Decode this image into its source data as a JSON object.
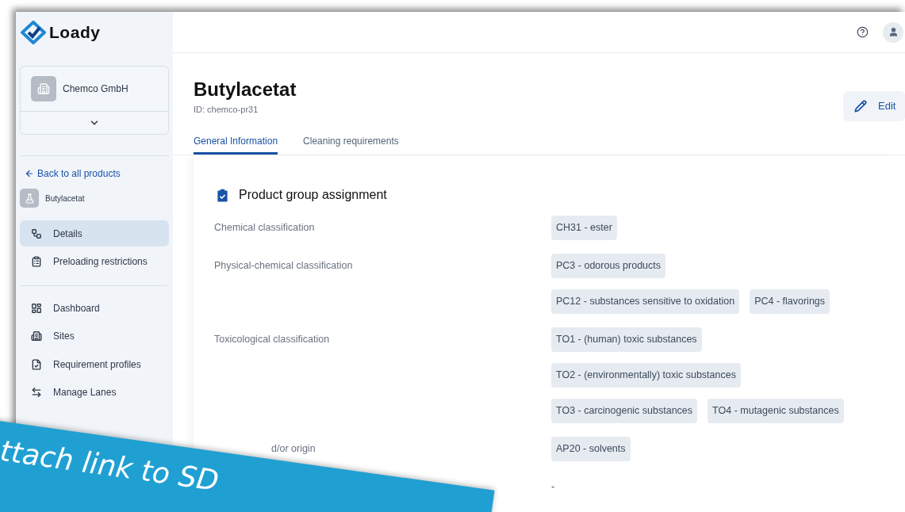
{
  "brand": {
    "name": "Loady"
  },
  "company": {
    "name": "Chemco GmbH"
  },
  "sidebar": {
    "back_link": "Back to all products",
    "product": "Butylacetat",
    "product_nav": [
      {
        "label": "Details",
        "selected": true
      },
      {
        "label": "Preloading restrictions",
        "selected": false
      }
    ],
    "main_nav": [
      {
        "label": "Dashboard",
        "selected": false
      },
      {
        "label": "Sites",
        "selected": false
      },
      {
        "label": "Requirement profiles",
        "selected": false
      },
      {
        "label": "Manage Lanes",
        "selected": false
      }
    ]
  },
  "page": {
    "title": "Butylacetat",
    "id": "ID: chemco-pr31",
    "edit_button": "Edit"
  },
  "tabs": [
    {
      "label": "General Information",
      "selected": true
    },
    {
      "label": "Cleaning requirements",
      "selected": false
    }
  ],
  "section": {
    "title": "Product group assignment",
    "rows": [
      {
        "label": "Chemical classification",
        "lines": [
          [
            "CH31 - ester"
          ]
        ]
      },
      {
        "label": "Physical-chemical classification",
        "lines": [
          [
            "PC3 - odorous products"
          ],
          [
            "PC12 - substances sensitive to oxidation",
            "PC4 - flavorings"
          ]
        ]
      },
      {
        "label": "Toxicological classification",
        "lines": [
          [
            "TO1 - (human) toxic substances"
          ],
          [
            "TO2 - (environmentally) toxic substances"
          ],
          [
            "TO3 - carcinogenic substances",
            "TO4 - mutagenic substances"
          ]
        ]
      },
      {
        "label": "d/or origin",
        "lines": [
          [
            "AP20 - solvents"
          ]
        ]
      },
      {
        "value": "-"
      }
    ]
  },
  "banner": {
    "text": "ttach link to SD"
  }
}
